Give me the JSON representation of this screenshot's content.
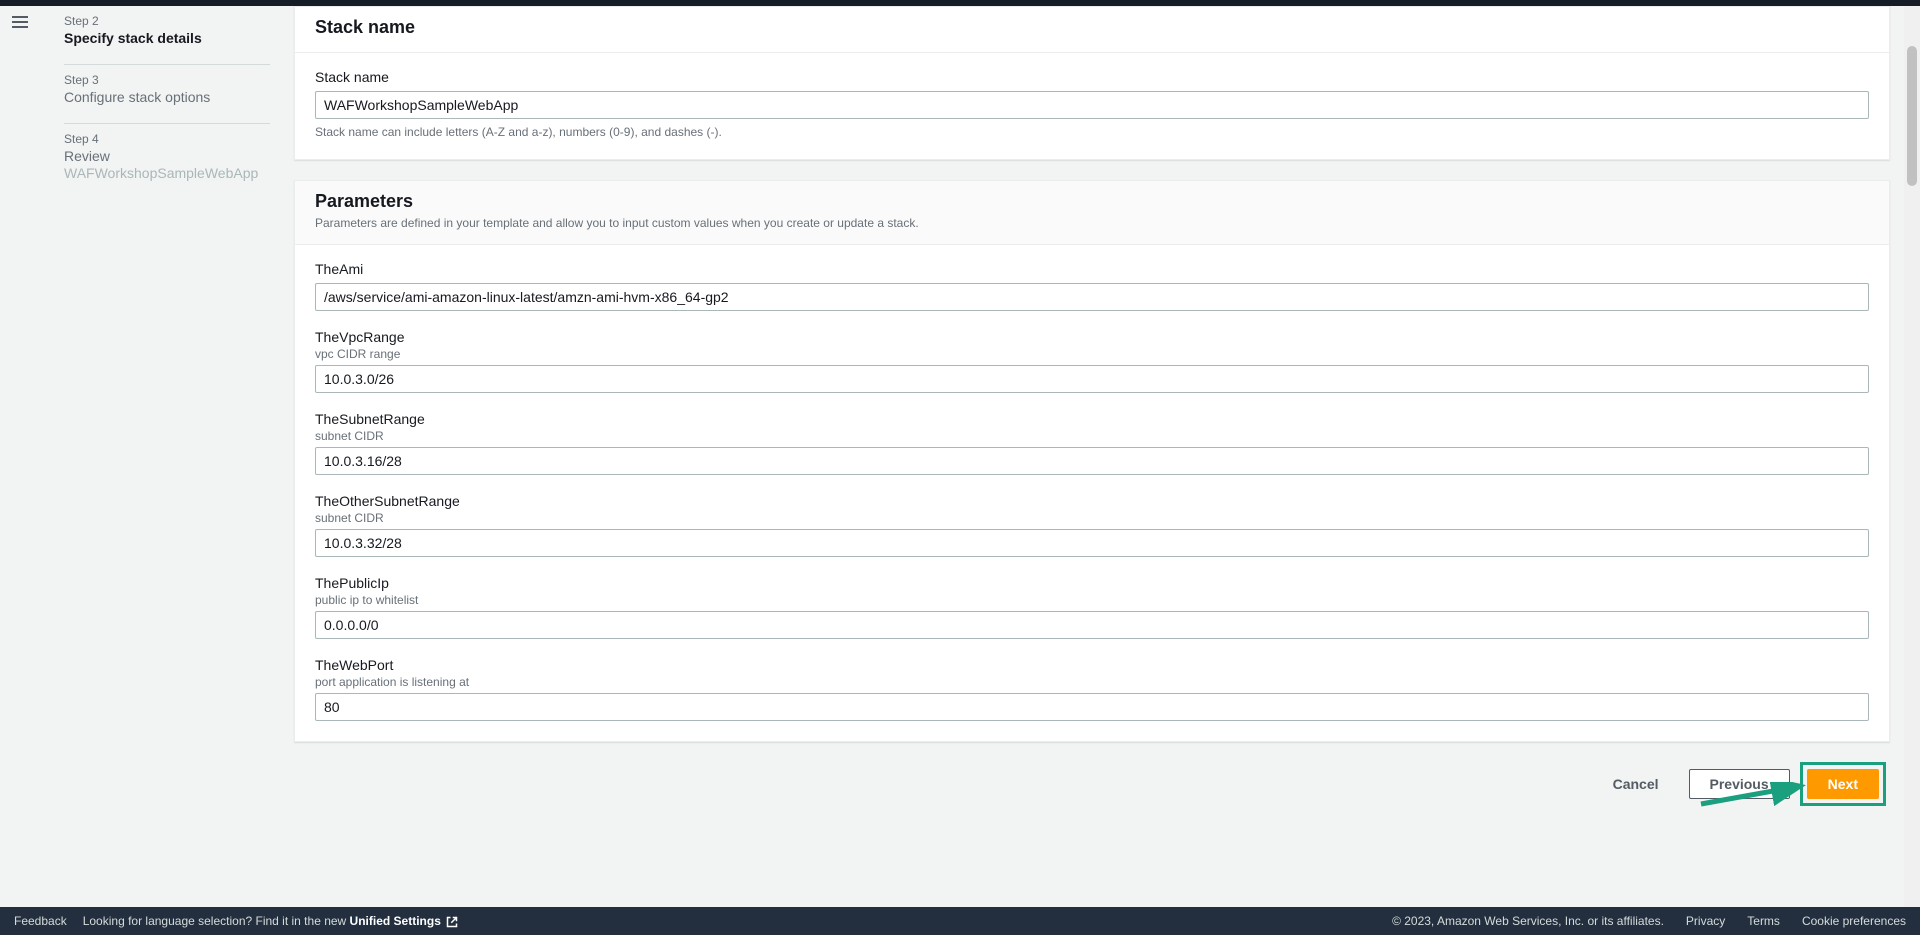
{
  "sidebar": {
    "steps": [
      {
        "label": "Step 2",
        "title": "Specify stack details",
        "active": true
      },
      {
        "label": "Step 3",
        "title": "Configure stack options",
        "active": false
      },
      {
        "label": "Step 4",
        "title": "Review",
        "subtitle": "WAFWorkshopSampleWebApp",
        "active": false
      }
    ]
  },
  "stack_name_panel": {
    "heading": "Stack name",
    "label": "Stack name",
    "value": "WAFWorkshopSampleWebApp",
    "help": "Stack name can include letters (A-Z and a-z), numbers (0-9), and dashes (-)."
  },
  "parameters_panel": {
    "heading": "Parameters",
    "desc": "Parameters are defined in your template and allow you to input custom values when you create or update a stack.",
    "fields": [
      {
        "label": "TheAmi",
        "sub": "",
        "value": "/aws/service/ami-amazon-linux-latest/amzn-ami-hvm-x86_64-gp2"
      },
      {
        "label": "TheVpcRange",
        "sub": "vpc CIDR range",
        "value": "10.0.3.0/26"
      },
      {
        "label": "TheSubnetRange",
        "sub": "subnet CIDR",
        "value": "10.0.3.16/28"
      },
      {
        "label": "TheOtherSubnetRange",
        "sub": "subnet CIDR",
        "value": "10.0.3.32/28"
      },
      {
        "label": "ThePublicIp",
        "sub": "public ip to whitelist",
        "value": "0.0.0.0/0"
      },
      {
        "label": "TheWebPort",
        "sub": "port application is listening at",
        "value": "80"
      }
    ]
  },
  "buttons": {
    "cancel": "Cancel",
    "previous": "Previous",
    "next": "Next"
  },
  "footer": {
    "feedback": "Feedback",
    "lang_text": "Looking for language selection? Find it in the new ",
    "unified": "Unified Settings",
    "copyright": "© 2023, Amazon Web Services, Inc. or its affiliates.",
    "privacy": "Privacy",
    "terms": "Terms",
    "cookie": "Cookie preferences"
  }
}
